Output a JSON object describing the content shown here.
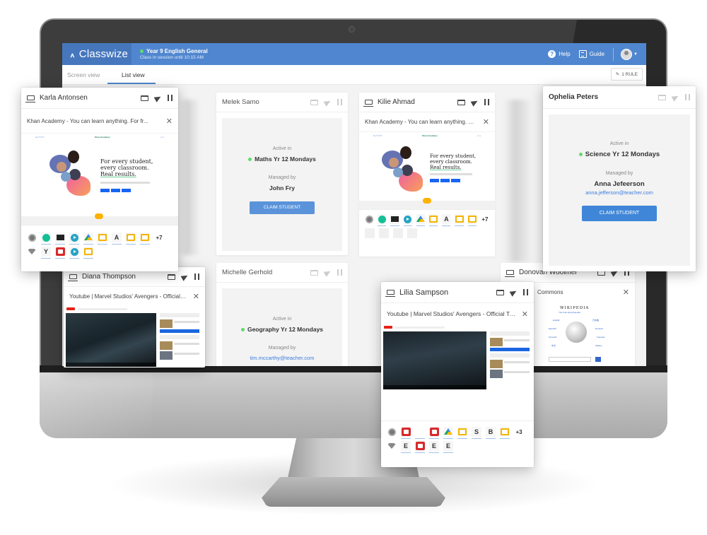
{
  "app": {
    "brand": "Classwize",
    "brand_logo": "꘍",
    "session_title": "Year 9 English General",
    "session_subtitle": "Class in session until 10:15 AM",
    "help_label": "Help",
    "guide_label": "Guide",
    "rule_button": "1 RULE",
    "colors": {
      "header": "#4f86cf",
      "online": "#5fdc6a",
      "claim_button": "#5a93da",
      "link": "#3b7ddd"
    }
  },
  "tabs": [
    {
      "label": "Screen view",
      "active": false
    },
    {
      "label": "List view",
      "active": true
    }
  ],
  "students": {
    "karla": {
      "name": "Karla Antonsen",
      "tab_title": "Khan Academy - You can learn anything. For fr...",
      "icons_row1": [
        "chrome-icon",
        "khan-academy-icon",
        "film-icon",
        "play-icon",
        "google-drive-icon",
        "google-slides-icon",
        "A",
        "google-slides-icon",
        "google-slides-icon"
      ],
      "icons_row2": [
        "wifi-icon",
        "Y",
        "youtube-icon",
        "play-icon",
        "google-slides-icon"
      ],
      "more": "+7",
      "letter_a": "A",
      "letter_y": "Y"
    },
    "melek": {
      "name": "Melek Samo",
      "active_label": "Active in",
      "class": "Maths Yr 12 Mondays",
      "managed_label": "Managed by",
      "manager": "John Fry",
      "claim_label": "CLAIM STUDENT"
    },
    "kilie": {
      "name": "Kilie Ahmad",
      "tab_title": "Khan Academy - You can learn anything. For fr...",
      "more": "+7",
      "letter_a": "A"
    },
    "ophelia": {
      "name": "Ophelia Peters",
      "active_label": "Active in",
      "class": "Science Yr 12 Mondays",
      "managed_label": "Managed by",
      "manager": "Anna Jefeerson",
      "manager_email": "anna.jefferson@teacher.com",
      "claim_label": "CLAIM STUDENT"
    },
    "diana": {
      "name": "Diana Thompson",
      "tab_title": "Youtube | Marvel Studios' Avengers - Official Tr..."
    },
    "michelle": {
      "name": "Michelle Gerhold",
      "active_label": "Active in",
      "class": "Geography Yr 12 Mondays",
      "managed_label": "Managed by",
      "manager_email": "tim.mccarthy@teacher.com"
    },
    "lilia": {
      "name": "Lilia Sampson",
      "tab_title": "Youtube | Marvel Studios' Avengers - Official Tr...",
      "more": "+3",
      "letter_s": "S",
      "letter_b": "B",
      "letter_e": "E"
    },
    "donovan": {
      "name": "Donovan Woolmer",
      "tab_title": "Commons"
    }
  },
  "khan_page": {
    "headline1": "For every student,",
    "headline2": "every classroom.",
    "headline3": "Real results.",
    "logo": "Khan Academy"
  },
  "wiki_page": {
    "title": "WIKIPEDIA",
    "subtitle": "The Free Encyclopedia"
  }
}
